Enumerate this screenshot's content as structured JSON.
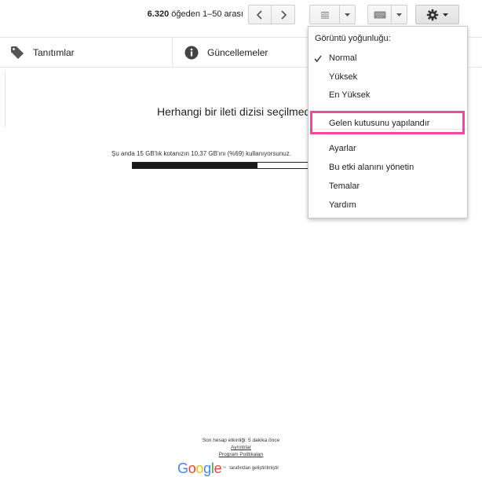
{
  "toolbar": {
    "pager_range": "6.320",
    "pager_rest": " öğeden 1–50 arası",
    "icons": {
      "prev": "chevron-left-icon",
      "next": "chevron-right-icon",
      "list": "list-density-icon",
      "dropdown": "caret-down-icon",
      "keyboard": "keyboard-icon",
      "settings": "gear-icon"
    }
  },
  "tabs": [
    {
      "label": "Tanıtımlar",
      "icon": "tag-icon"
    },
    {
      "label": "Güncellemeler",
      "icon": "info-icon"
    }
  ],
  "main": {
    "empty_title": "Herhangi bir ileti dizisi seçilmedi",
    "quota_text": "Şu anda 15 GB'lık kotanızın 10,37 GB'ını (%69) kullanıyorsunuz.",
    "quota_percent": 69
  },
  "settings_menu": {
    "heading": "Görüntü yoğunluğu:",
    "density_items": [
      {
        "label": "Normal",
        "checked": true
      },
      {
        "label": "Yüksek",
        "checked": false
      },
      {
        "label": "En Yüksek",
        "checked": false
      }
    ],
    "configure_inbox": "Gelen kutusunu yapılandır",
    "items": [
      {
        "label": "Ayarlar"
      },
      {
        "label": "Bu etki alanını yönetin"
      },
      {
        "label": "Temalar"
      },
      {
        "label": "Yardım"
      }
    ],
    "highlight_color": "#ee4b9e"
  },
  "footer": {
    "last_activity": "Son hesap etkinliği: 5 dakika önce",
    "details_link": "Ayrıntılar",
    "policies_link": "Program Politikaları",
    "brand": "Google",
    "tm": "™",
    "powered_by": "tarafından geliştirilmiştir",
    "brand_colors": [
      "#4285F4",
      "#EA4335",
      "#FBBC05",
      "#4285F4",
      "#34A853",
      "#EA4335"
    ]
  }
}
